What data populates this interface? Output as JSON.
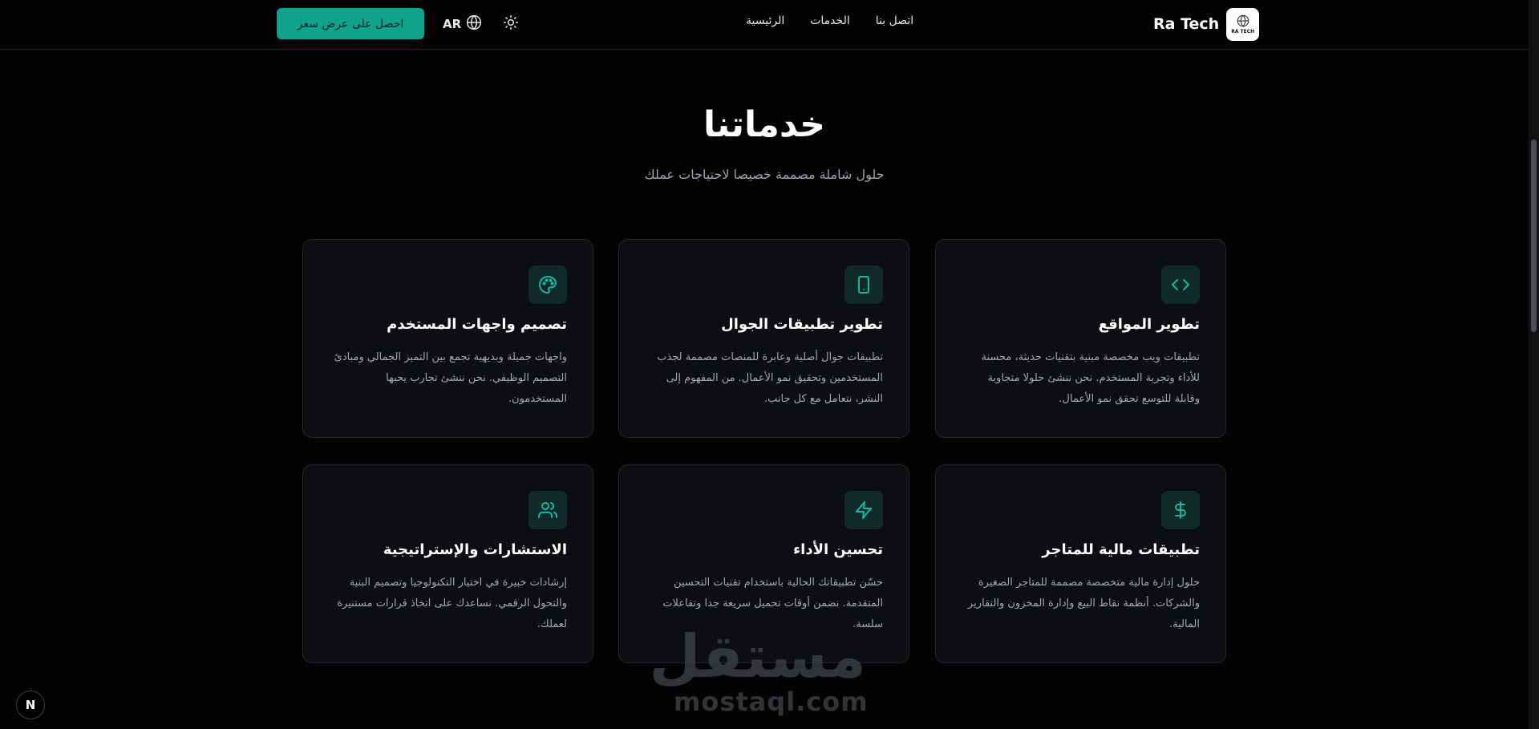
{
  "header": {
    "brand_name": "Ra Tech",
    "logo_text": "RA TECH",
    "nav_items": [
      {
        "label": "الرئيسية"
      },
      {
        "label": "الخدمات"
      },
      {
        "label": "اتصل بنا"
      }
    ],
    "language_label": "AR",
    "cta_label": "احصل على عرض سعر"
  },
  "services": {
    "title": "خدماتنا",
    "subtitle": "حلول شاملة مصممة خصيصا لاحتياجات عملك",
    "cards": [
      {
        "icon": "code-icon",
        "title": "تطوير المواقع",
        "description": "تطبيقات ويب مخصصة مبنية بتقنيات حديثة، محسنة للأداء وتجربة المستخدم. نحن ننشئ حلولا متجاوبة وقابلة للتوسع تحقق نمو الأعمال."
      },
      {
        "icon": "smartphone-icon",
        "title": "تطوير تطبيقات الجوال",
        "description": "تطبيقات جوال أصلية وعابرة للمنصات مصممة لجذب المستخدمين وتحقيق نمو الأعمال. من المفهوم إلى النشر، نتعامل مع كل جانب."
      },
      {
        "icon": "palette-icon",
        "title": "تصميم واجهات المستخدم",
        "description": "واجهات جميلة وبديهية تجمع بين التميز الجمالي ومبادئ التصميم الوظيفي. نحن ننشئ تجارب يحبها المستخدمون."
      },
      {
        "icon": "dollar-icon",
        "title": "تطبيقات مالية للمتاجر",
        "description": "حلول إدارة مالية متخصصة مصممة للمتاجر الصغيرة والشركات. أنظمة نقاط البيع وإدارة المخزون والتقارير المالية."
      },
      {
        "icon": "zap-icon",
        "title": "تحسين الأداء",
        "description": "حسّن تطبيقاتك الحالية باستخدام تقنيات التحسين المتقدمة. نضمن أوقات تحميل سريعة جدا وتفاعلات سلسة."
      },
      {
        "icon": "users-icon",
        "title": "الاستشارات والإستراتيجية",
        "description": "إرشادات خبيرة في اختيار التكنولوجيا وتصميم البنية والتحول الرقمي. نساعدك على اتخاذ قرارات مستنيرة لعملك."
      }
    ]
  },
  "watermark": {
    "arabic": "مستقل",
    "latin": "mostaql.com"
  },
  "badge": {
    "label": "N"
  },
  "colors": {
    "accent": "#10a38c",
    "background": "#030303",
    "card_background": "#0c0e11",
    "icon_background": "#0f2a27"
  }
}
